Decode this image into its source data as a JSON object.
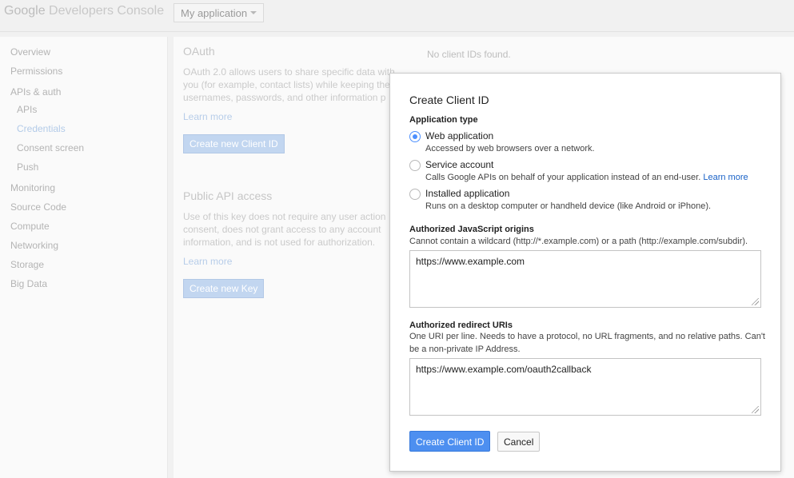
{
  "header": {
    "logo_google": "Google",
    "logo_product": "Developers Console",
    "project_selector": "My application"
  },
  "sidebar": {
    "items": [
      {
        "label": "Overview"
      },
      {
        "label": "Permissions"
      },
      {
        "label": "APIs & auth"
      },
      {
        "label": "APIs"
      },
      {
        "label": "Credentials"
      },
      {
        "label": "Consent screen"
      },
      {
        "label": "Push"
      },
      {
        "label": "Monitoring"
      },
      {
        "label": "Source Code"
      },
      {
        "label": "Compute"
      },
      {
        "label": "Networking"
      },
      {
        "label": "Storage"
      },
      {
        "label": "Big Data"
      }
    ]
  },
  "main": {
    "oauth": {
      "title": "OAuth",
      "description": "OAuth 2.0 allows users to share specific data with you (for example, contact lists) while keeping their usernames, passwords, and other information p",
      "learn_more": "Learn more",
      "button": "Create new Client ID",
      "empty_state": "No client IDs found."
    },
    "public_api": {
      "title": "Public API access",
      "description": "Use of this key does not require any user action consent, does not grant access to any account information, and is not used for authorization.",
      "learn_more": "Learn more",
      "button": "Create new Key"
    }
  },
  "dialog": {
    "title": "Create Client ID",
    "app_type_label": "Application type",
    "options": [
      {
        "label": "Web application",
        "description": "Accessed by web browsers over a network.",
        "checked": true
      },
      {
        "label": "Service account",
        "description": "Calls Google APIs on behalf of your application instead of an end-user.",
        "link": "Learn more",
        "checked": false
      },
      {
        "label": "Installed application",
        "description": "Runs on a desktop computer or handheld device (like Android or iPhone).",
        "checked": false
      }
    ],
    "js_origins": {
      "label": "Authorized JavaScript origins",
      "help": "Cannot contain a wildcard (http://*.example.com) or a path (http://example.com/subdir).",
      "value": "https://www.example.com"
    },
    "redirect_uris": {
      "label": "Authorized redirect URIs",
      "help": "One URI per line. Needs to have a protocol, no URL fragments, and no relative paths. Can't be a non-private IP Address.",
      "value": "https://www.example.com/oauth2callback"
    },
    "submit_label": "Create Client ID",
    "cancel_label": "Cancel"
  },
  "colors": {
    "primary": "#4d8ff0",
    "link": "#1a62c7"
  }
}
